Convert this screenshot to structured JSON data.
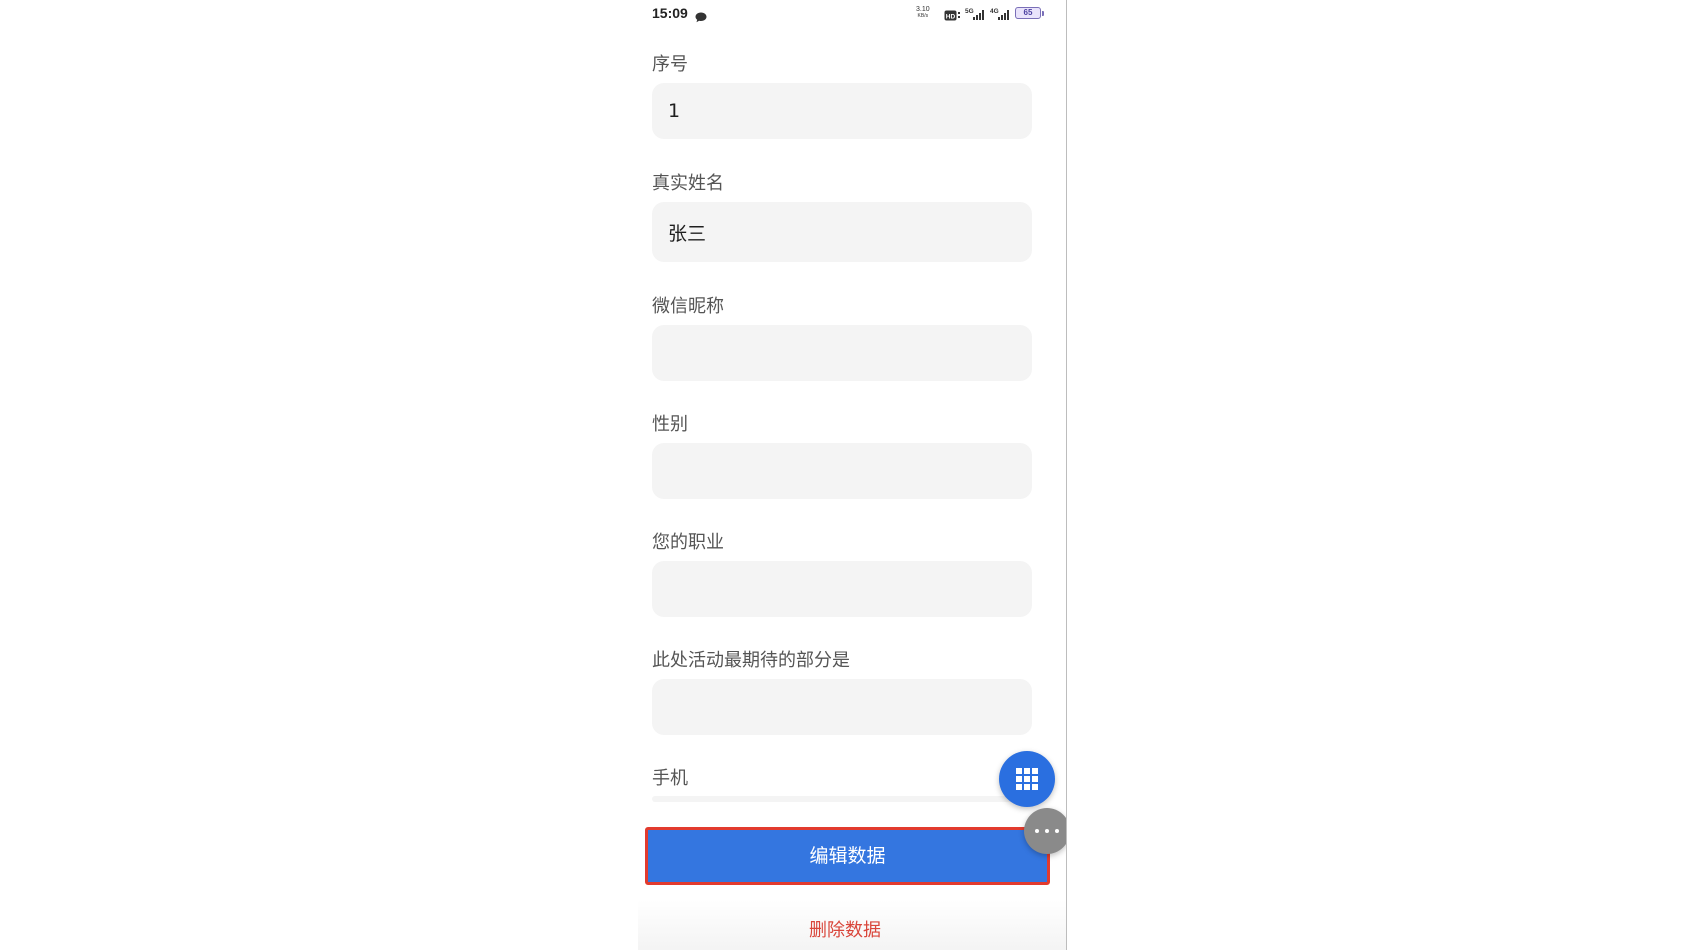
{
  "status_bar": {
    "time": "15:09",
    "net_speed_value": "3.10",
    "net_speed_unit": "KB/s",
    "hd_label": "HD",
    "network_5g": "5G",
    "network_4g": "4G",
    "battery": "65"
  },
  "form": {
    "fields": [
      {
        "label": "序号",
        "value": "1"
      },
      {
        "label": "真实姓名",
        "value": "张三"
      },
      {
        "label": "微信昵称",
        "value": ""
      },
      {
        "label": "性别",
        "value": ""
      },
      {
        "label": "您的职业",
        "value": ""
      },
      {
        "label": "此处活动最期待的部分是",
        "value": ""
      },
      {
        "label": "手机",
        "value": ""
      }
    ]
  },
  "actions": {
    "edit_label": "编辑数据",
    "delete_label": "删除数据"
  },
  "colors": {
    "primary": "#3476e0",
    "highlight_border": "#e23b2e",
    "delete_text": "#d9463b",
    "input_bg": "#f4f4f4"
  },
  "icons": {
    "grid_fab": "grid-icon",
    "more_fab": "more-dots-icon",
    "status_chat": "chat-bubble-icon"
  }
}
